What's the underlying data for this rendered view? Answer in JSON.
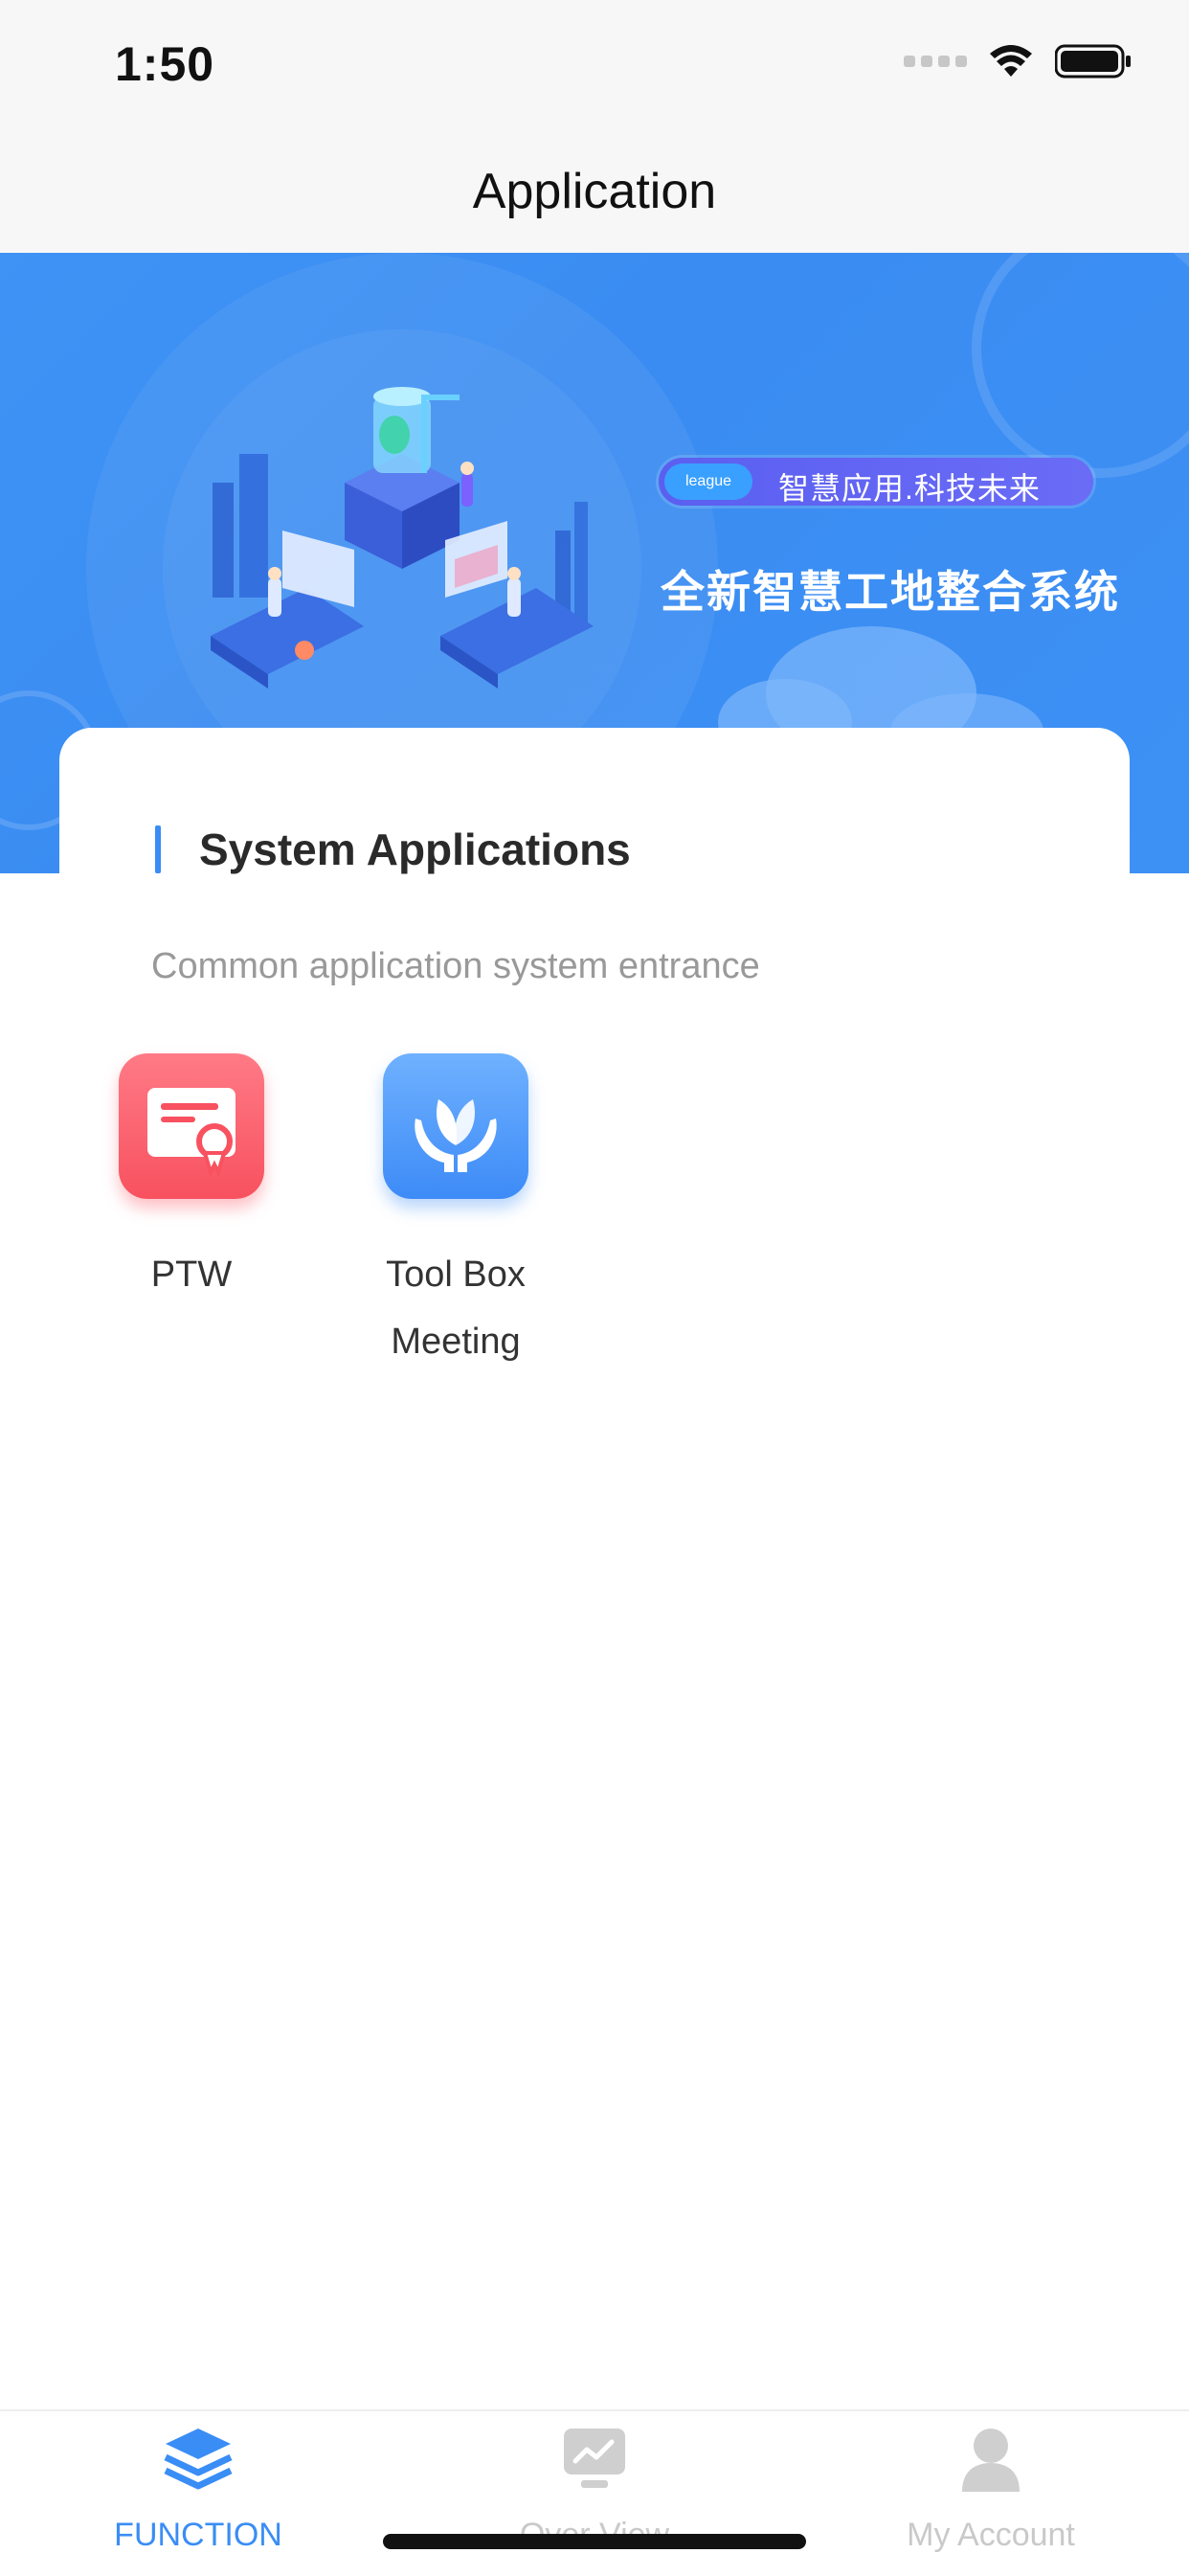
{
  "status_bar": {
    "time": "1:50"
  },
  "nav": {
    "title": "Application"
  },
  "banner": {
    "pill_badge": "league",
    "pill_text": "智慧应用.科技未来",
    "headline": "全新智慧工地整合系统"
  },
  "section": {
    "title": "System Applications",
    "subtitle": "Common application system entrance"
  },
  "apps": [
    {
      "label": "PTW",
      "icon": "certificate-icon",
      "color": "#f8515f"
    },
    {
      "label_line1": "Tool Box",
      "label_line2": "Meeting",
      "icon": "leaf-hands-icon",
      "color": "#3d8bf7"
    }
  ],
  "tabs": [
    {
      "label": "FUNCTION",
      "icon": "layers-icon",
      "active": true
    },
    {
      "label": "Over View",
      "icon": "chart-monitor-icon",
      "active": false
    },
    {
      "label": "My Account",
      "icon": "person-icon",
      "active": false
    }
  ],
  "colors": {
    "accent": "#3a8df5",
    "banner": "#3d90f4",
    "inactive": "#c9c9c9"
  }
}
